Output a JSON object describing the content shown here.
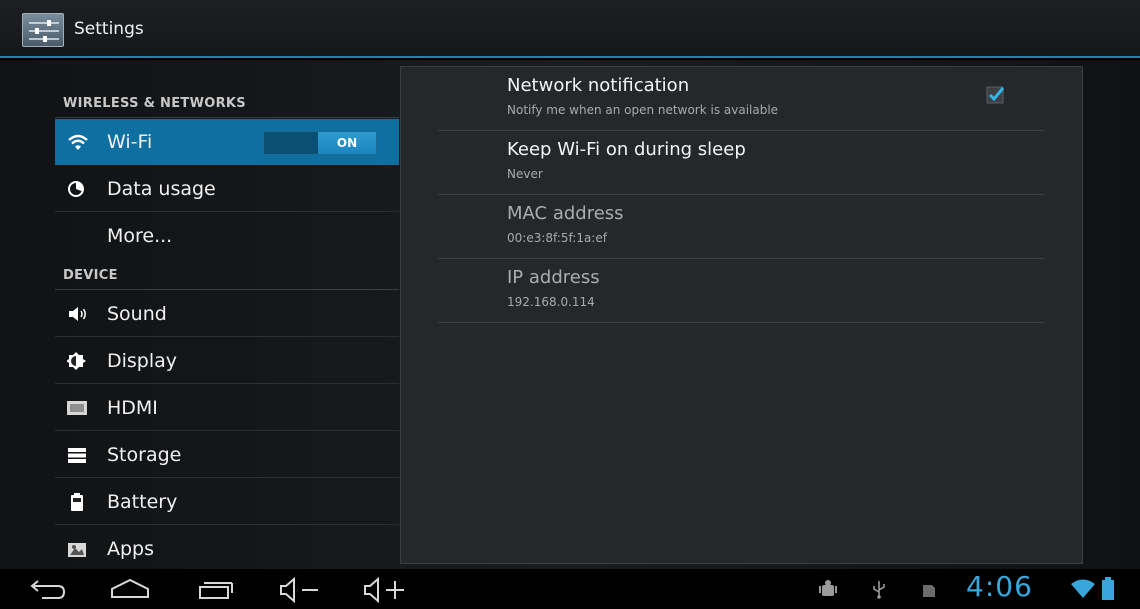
{
  "actionbar": {
    "title": "Settings",
    "icon": "settings-sliders-icon"
  },
  "sidebar": {
    "sections": [
      {
        "header": "WIRELESS & NETWORKS"
      },
      {
        "header": "DEVICE"
      }
    ],
    "items": [
      {
        "label": "Wi-Fi",
        "icon": "wifi-icon",
        "toggle": "ON",
        "selected": true
      },
      {
        "label": "Data usage",
        "icon": "data-usage-icon"
      },
      {
        "label": "More..."
      },
      {
        "label": "Sound",
        "icon": "speaker-icon"
      },
      {
        "label": "Display",
        "icon": "brightness-icon"
      },
      {
        "label": "HDMI",
        "icon": "hdmi-icon"
      },
      {
        "label": "Storage",
        "icon": "storage-icon"
      },
      {
        "label": "Battery",
        "icon": "battery-icon"
      },
      {
        "label": "Apps",
        "icon": "apps-icon"
      }
    ]
  },
  "wifi_settings": [
    {
      "title": "Network notification",
      "summary": "Notify me when an open network is available",
      "checked": true
    },
    {
      "title": "Keep Wi-Fi on during sleep",
      "summary": "Never"
    },
    {
      "title": "MAC address",
      "summary": "00:e3:8f:5f:1a:ef"
    },
    {
      "title": "IP address",
      "summary": "192.168.0.114"
    }
  ],
  "navbar": {
    "buttons": [
      "back-icon",
      "home-icon",
      "recent-apps-icon",
      "volume-down-icon",
      "volume-up-icon"
    ],
    "status_icons": [
      "android-debug-icon",
      "usb-icon",
      "sd-card-icon",
      "wifi-signal-icon",
      "battery-full-icon"
    ],
    "clock": "4:06"
  },
  "colors": {
    "accent": "#0e6fa0",
    "clock": "#38a6db",
    "divider": "#2a7ea6"
  }
}
